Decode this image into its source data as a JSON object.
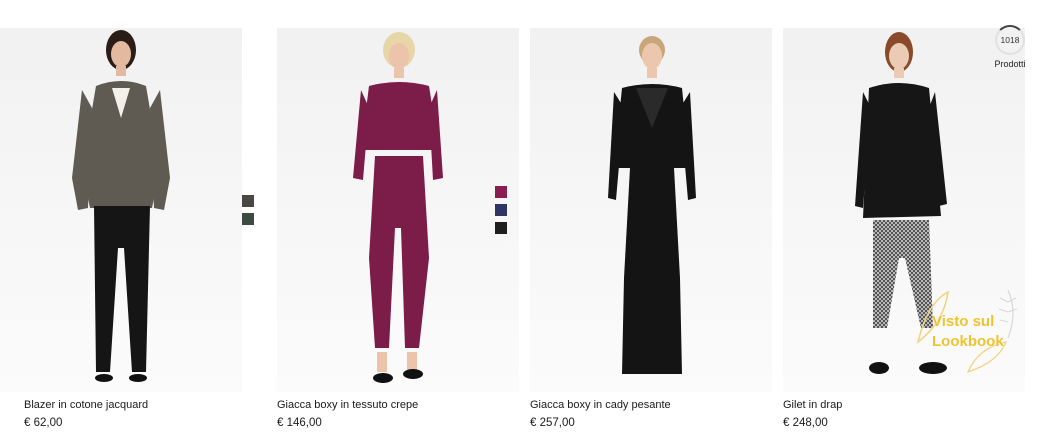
{
  "products": [
    {
      "name": "Blazer in cotone jacquard",
      "price": "€ 62,00",
      "swatches": [
        "#4a4843",
        "#3c4a42"
      ]
    },
    {
      "name": "Giacca boxy in tessuto crepe",
      "price": "€ 146,00",
      "swatches": [
        "#8a1f4f",
        "#2e3566",
        "#1f1f1f"
      ]
    },
    {
      "name": "Giacca boxy in cady pesante",
      "price": "€ 257,00",
      "swatches": []
    },
    {
      "name": "Gilet in drap",
      "price": "€ 248,00",
      "swatches": []
    }
  ],
  "counter": {
    "value": "1018",
    "label": "Prodotti"
  },
  "badge": {
    "line1": "Visto sul",
    "line2": "Lookbook",
    "color": "#f0c230"
  },
  "icons": [
    "product-counter-icon",
    "lookbook-leaf-icon"
  ]
}
